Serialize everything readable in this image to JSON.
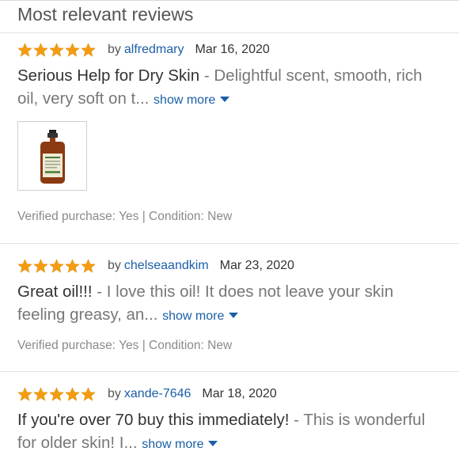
{
  "heading": "Most relevant reviews",
  "star_color": "#f39c12",
  "link_color": "#1b5fa6",
  "reviews": [
    {
      "rating": 5,
      "by": "by",
      "author": "alfredmary",
      "date": "Mar 16, 2020",
      "title": "Serious Help for Dry Skin",
      "separator": " - ",
      "excerpt": "Delightful scent, smooth, rich oil, very soft on t...",
      "show_more": "show more",
      "image": "product-bottle-thumbnail",
      "verified": "Verified purchase: Yes | Condition: New"
    },
    {
      "rating": 5,
      "by": "by",
      "author": "chelseaandkim",
      "date": "Mar 23, 2020",
      "title": "Great oil!!!",
      "separator": " - ",
      "excerpt": "I love this oil! It does not leave your skin feeling greasy, an...",
      "show_more": "show more",
      "verified": "Verified purchase: Yes | Condition: New"
    },
    {
      "rating": 5,
      "by": "by",
      "author": "xande-7646",
      "date": "Mar 18, 2020",
      "title": "If you're over 70 buy this immediately!",
      "separator": " - ",
      "excerpt": "This is wonderful for older skin! I...",
      "show_more": "show more"
    }
  ]
}
